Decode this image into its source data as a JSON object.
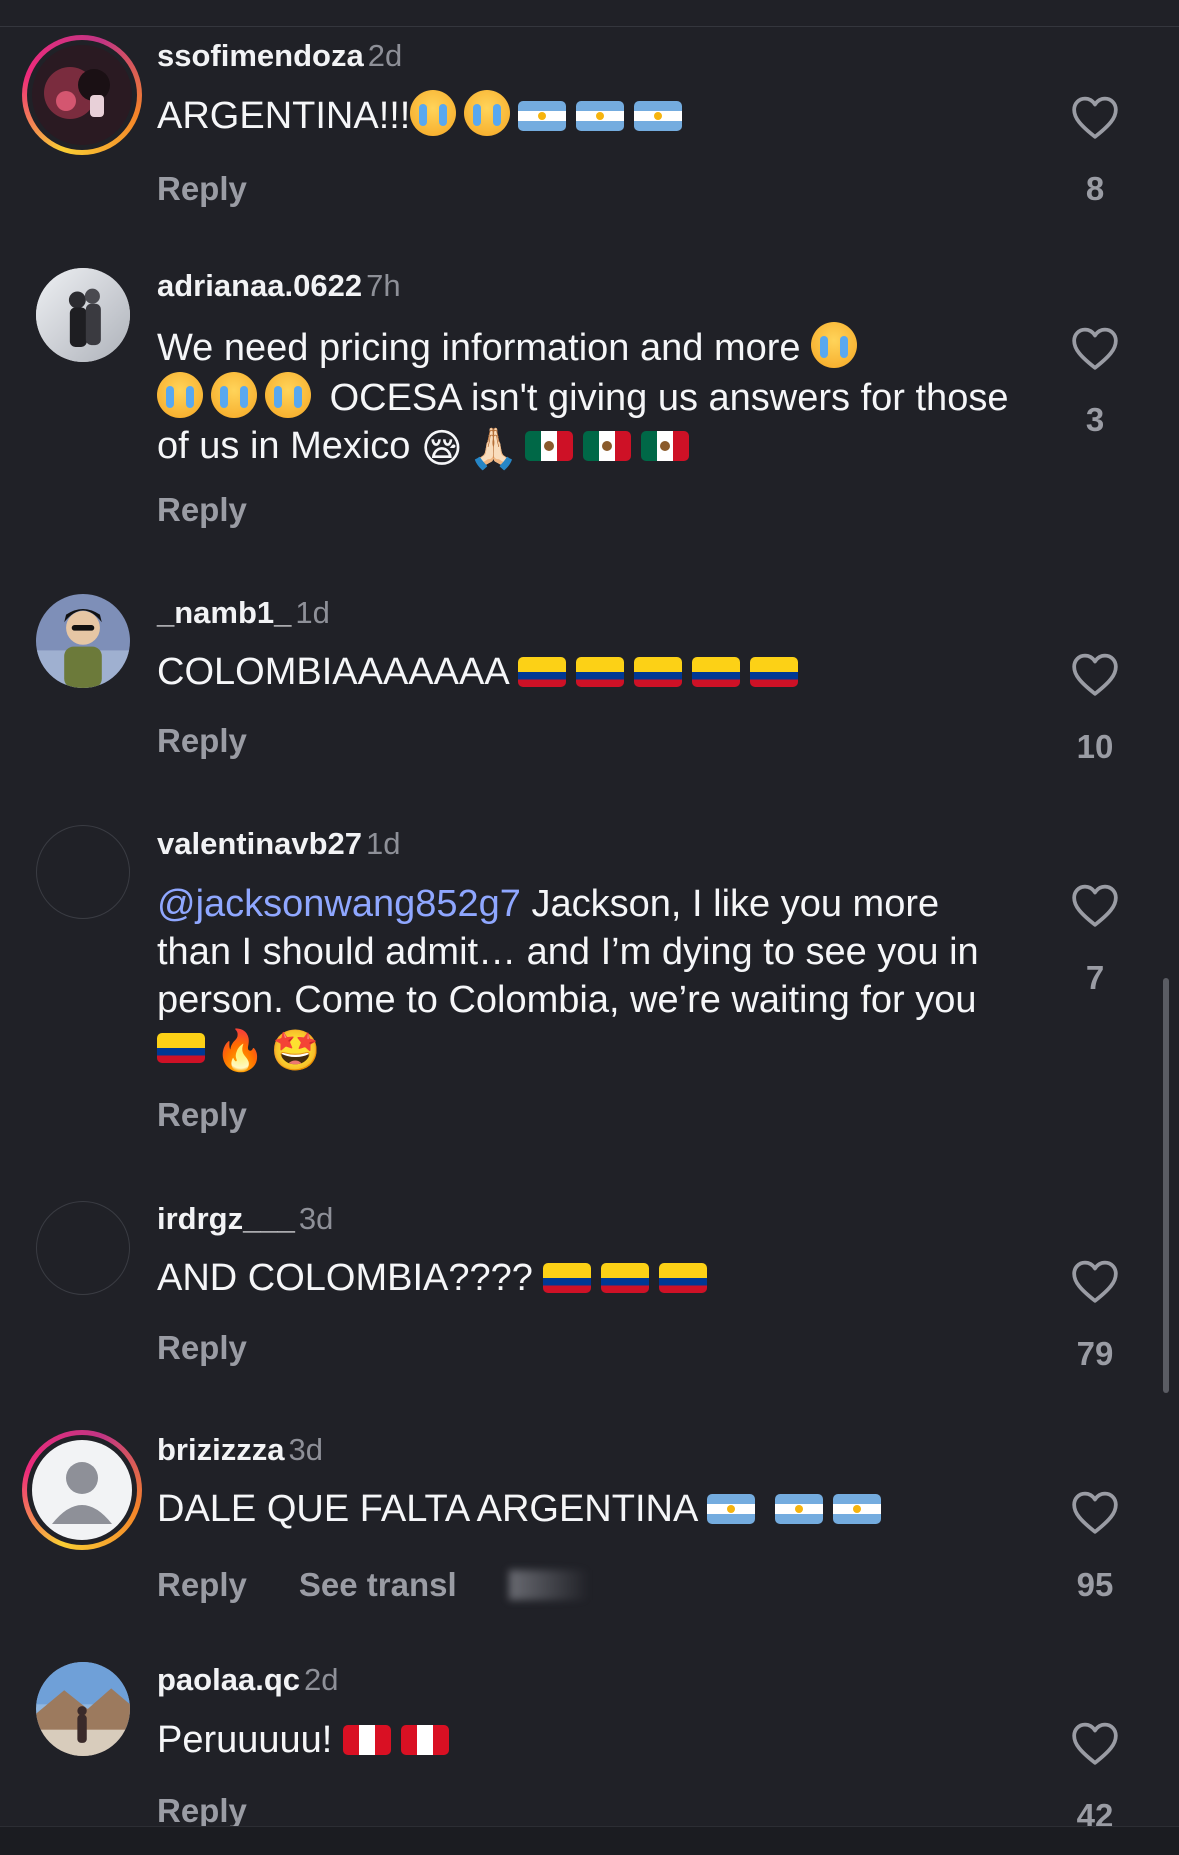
{
  "comments": [
    {
      "username": "ssofimendoza",
      "time": "2d",
      "text": "ARGENTINA!!!",
      "reply_label": "Reply",
      "likes": "8"
    },
    {
      "username": "adrianaa.0622",
      "time": "7h",
      "text_1": "We need pricing information and more",
      "text_2": "OCESA isn't giving us answers for those of us in Mexico",
      "reply_label": "Reply",
      "likes": "3"
    },
    {
      "username": "_namb1_",
      "time": "1d",
      "text": "COLOMBIAAAAAAA",
      "reply_label": "Reply",
      "likes": "10"
    },
    {
      "username": "valentinavb27",
      "time": "1d",
      "mention": "@jacksonwang852g7",
      "text": "Jackson, I like you more than I should admit… and I’m dying to see you in person. Come to Colombia, we’re waiting for you",
      "reply_label": "Reply",
      "likes": "7"
    },
    {
      "username": "irdrgz___",
      "time": "3d",
      "text": "AND COLOMBIA????",
      "reply_label": "Reply",
      "likes": "79"
    },
    {
      "username": "brizizzza",
      "time": "3d",
      "text": "DALE QUE FALTA ARGENTINA",
      "reply_label": "Reply",
      "see_translation_label": "See transl",
      "likes": "95"
    },
    {
      "username": "paolaa.qc",
      "time": "2d",
      "text": "Peruuuuu!",
      "reply_label": "Reply",
      "likes": "42"
    }
  ],
  "icons": {
    "like": "heart-outline-icon",
    "default_avatar": "person-silhouette-icon",
    "fire": "🔥",
    "star_struck": "🤩",
    "pleading": "🙏🏻",
    "sad": "😪"
  },
  "colors": {
    "background": "#202127",
    "mention": "#8fa7ff",
    "secondary_text": "#9a9ca4",
    "story_ring": "#ee2a7b"
  }
}
